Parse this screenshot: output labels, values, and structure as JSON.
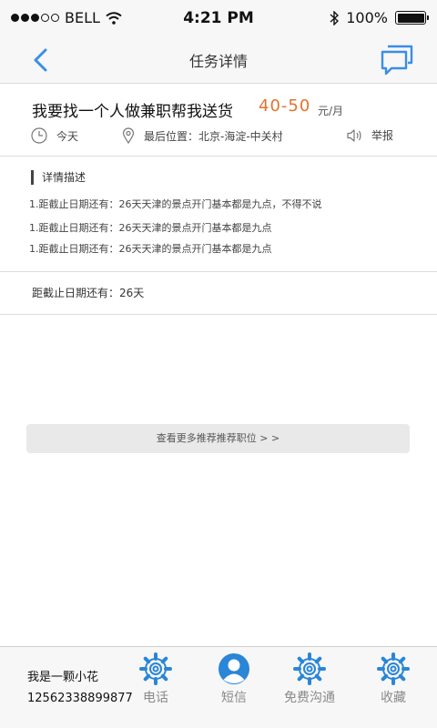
{
  "status_bar": {
    "carrier": "BELL",
    "time": "4:21 PM",
    "battery": "100%",
    "battery_level": 1.0
  },
  "nav": {
    "title": "任务详情",
    "back_icon": "chevron-left-icon",
    "chat_icon": "chat-bubbles-icon",
    "accent": "#3a8ee6"
  },
  "job": {
    "title": "我要找一个人做兼职帮我送货",
    "price": "40-50",
    "unit": "元/月",
    "price_color": "#e5722f",
    "time_label": "今天",
    "location_label": "最后位置：北京-海淀-中关村",
    "report_label": "举报"
  },
  "details": {
    "heading": "详情描述",
    "lines": [
      "1.距截止日期还有：26天天津的景点开门基本都是九点，不得不说",
      "1.距截止日期还有：26天天津的景点开门基本都是九点",
      "1.距截止日期还有：26天天津的景点开门基本都是九点"
    ]
  },
  "deadline": "距截止日期还有：26天",
  "more_button": "查看更多推荐推荐职位 > >",
  "bottom_bar": {
    "user_name": "我是一颗小花",
    "user_phone": "12562338899877",
    "tabs": [
      {
        "label": "电话",
        "icon": "gear-icon"
      },
      {
        "label": "短信",
        "icon": "user-avatar-icon"
      },
      {
        "label": "免费沟通",
        "icon": "gear-icon"
      },
      {
        "label": "收藏",
        "icon": "gear-icon"
      }
    ]
  }
}
